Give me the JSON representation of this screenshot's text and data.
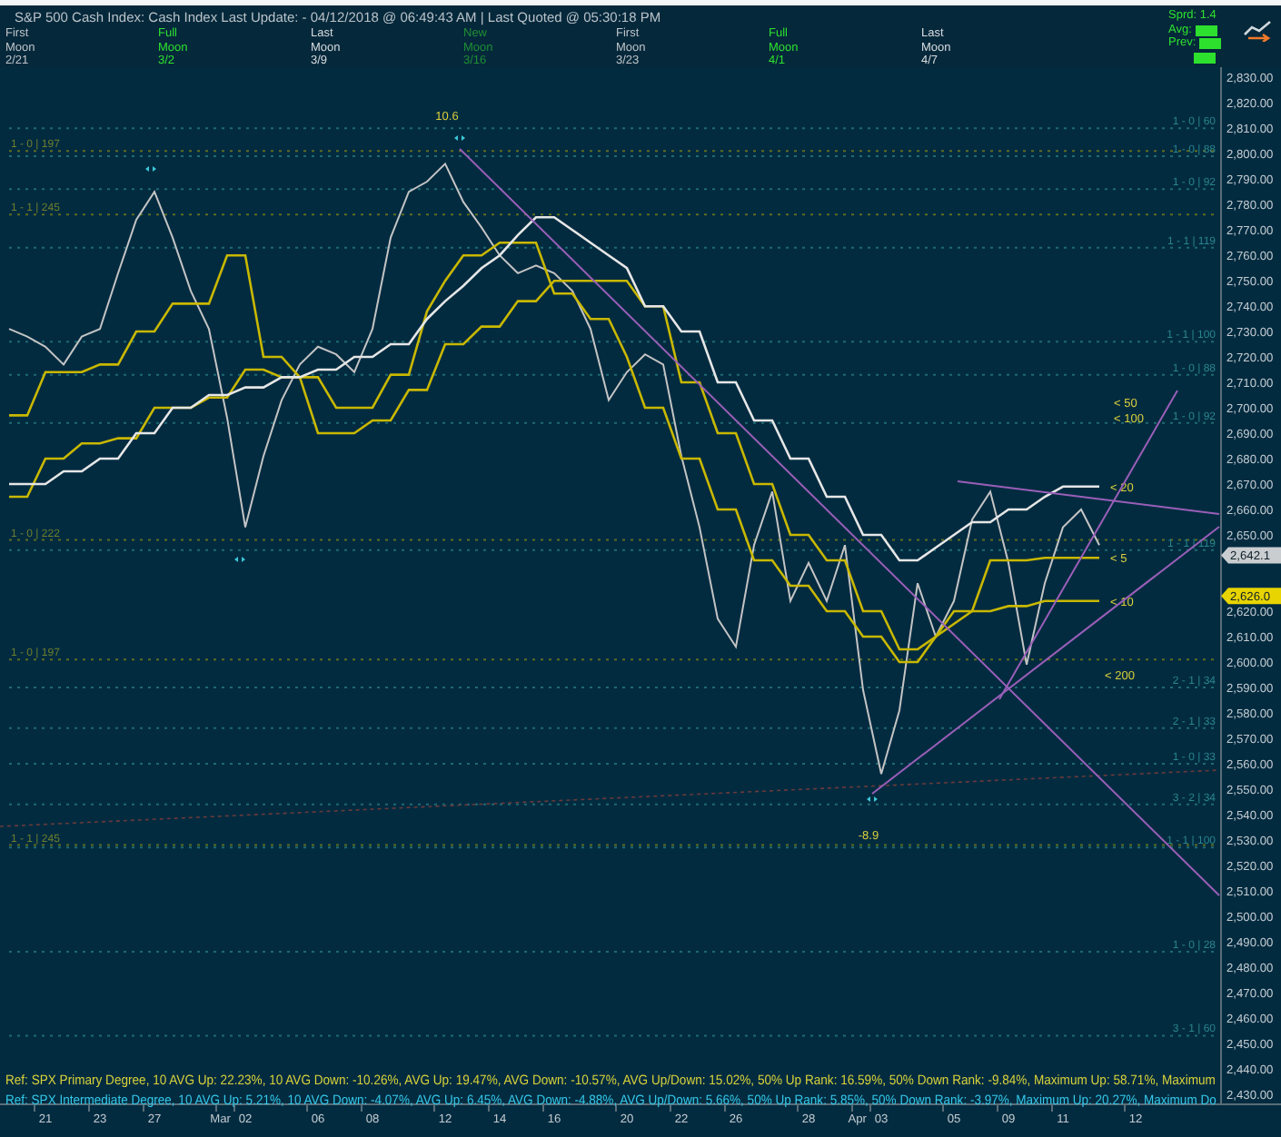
{
  "header": {
    "title_rest": ":  Cash Index  Last Update:  - 04/12/2018 @ 06:49:43 AM | Last Quoted @ 05:30:18 PM",
    "moon_phases": [
      {
        "kind": "first",
        "lines": [
          "First",
          "Moon",
          "2/21"
        ]
      },
      {
        "kind": "full",
        "lines": [
          "Full",
          "Moon",
          "3/2"
        ]
      },
      {
        "kind": "last",
        "lines": [
          "Last",
          "Moon",
          "3/9"
        ]
      },
      {
        "kind": "new",
        "lines": [
          "New",
          "Moon",
          "3/16"
        ]
      },
      {
        "kind": "first",
        "lines": [
          "First",
          "Moon",
          "3/23"
        ]
      },
      {
        "kind": "full",
        "lines": [
          "Full",
          "Moon",
          "4/1"
        ]
      },
      {
        "kind": "last",
        "lines": [
          "Last",
          "Moon",
          "4/7"
        ]
      }
    ],
    "spread": "Sprd: 1.4",
    "avg_label": "Avg:",
    "prev_label": "Prev:"
  },
  "chart": {
    "chart_data": {
      "type": "line",
      "grid": true,
      "ylim": [
        2426,
        2834
      ],
      "categories": [
        null,
        null,
        "21",
        null,
        null,
        "23",
        null,
        null,
        "27",
        null,
        null,
        null,
        "Mar",
        "02",
        null,
        null,
        null,
        "06",
        null,
        null,
        "08",
        null,
        null,
        null,
        "12",
        null,
        null,
        "14",
        null,
        null,
        "16",
        null,
        null,
        null,
        "20",
        null,
        null,
        "22",
        null,
        null,
        "26",
        null,
        null,
        null,
        "28",
        null,
        null,
        "Apr",
        "03",
        null,
        null,
        null,
        "05",
        null,
        null,
        "09",
        null,
        null,
        "11",
        null,
        null,
        null,
        "12"
      ],
      "yticks": [
        {
          "value": 2830,
          "label": "2,830.00"
        },
        {
          "value": 2820,
          "label": "2,820.00"
        },
        {
          "value": 2810,
          "label": "2,810.00"
        },
        {
          "value": 2800,
          "label": "2,800.00"
        },
        {
          "value": 2790,
          "label": "2,790.00"
        },
        {
          "value": 2780,
          "label": "2,780.00"
        },
        {
          "value": 2770,
          "label": "2,770.00"
        },
        {
          "value": 2760,
          "label": "2,760.00"
        },
        {
          "value": 2750,
          "label": "2,750.00"
        },
        {
          "value": 2740,
          "label": "2,740.00"
        },
        {
          "value": 2730,
          "label": "2,730.00"
        },
        {
          "value": 2720,
          "label": "2,720.00"
        },
        {
          "value": 2710,
          "label": "2,710.00"
        },
        {
          "value": 2700,
          "label": "2,700.00"
        },
        {
          "value": 2690,
          "label": "2,690.00"
        },
        {
          "value": 2680,
          "label": "2,680.00"
        },
        {
          "value": 2670,
          "label": "2,670.00"
        },
        {
          "value": 2660,
          "label": "2,660.00"
        },
        {
          "value": 2650,
          "label": "2,650.00"
        },
        {
          "value": 2620,
          "label": "2,620.00"
        },
        {
          "value": 2610,
          "label": "2,610.00"
        },
        {
          "value": 2600,
          "label": "2,600.00"
        },
        {
          "value": 2590,
          "label": "2,590.00"
        },
        {
          "value": 2580,
          "label": "2,580.00"
        },
        {
          "value": 2570,
          "label": "2,570.00"
        },
        {
          "value": 2560,
          "label": "2,560.00"
        },
        {
          "value": 2550,
          "label": "2,550.00"
        },
        {
          "value": 2540,
          "label": "2,540.00"
        },
        {
          "value": 2530,
          "label": "2,530.00"
        },
        {
          "value": 2520,
          "label": "2,520.00"
        },
        {
          "value": 2510,
          "label": "2,510.00"
        },
        {
          "value": 2500,
          "label": "2,500.00"
        },
        {
          "value": 2490,
          "label": "2,490.00"
        },
        {
          "value": 2480,
          "label": "2,480.00"
        },
        {
          "value": 2470,
          "label": "2,470.00"
        },
        {
          "value": 2460,
          "label": "2,460.00"
        },
        {
          "value": 2450,
          "label": "2,450.00"
        },
        {
          "value": 2440,
          "label": "2,440.00"
        },
        {
          "value": 2430,
          "label": "2,430.00"
        }
      ],
      "series": [
        {
          "name": "S&P 500 Cash Index",
          "color": "#c4c4c4",
          "values": [
            2731,
            2728,
            2724,
            2717,
            2728,
            2731,
            2753,
            2774,
            2785,
            2767,
            2746,
            2731,
            2696,
            2653,
            2681,
            2703,
            2717,
            2724,
            2721,
            2714,
            2731,
            2767,
            2785,
            2789,
            2796,
            2781,
            2771,
            2760,
            2753,
            2756,
            2753,
            2746,
            2731,
            2703,
            2714,
            2721,
            2717,
            2681,
            2653,
            2617,
            2606,
            2646,
            2667,
            2624,
            2639,
            2624,
            2646,
            2589,
            2556,
            2581,
            2631,
            2610,
            2624,
            2656,
            2667,
            2639,
            2599,
            2631,
            2653,
            2660,
            2646,
            null,
            null
          ]
        },
        {
          "name": "< 5",
          "color": "#c9b800",
          "values": [
            2697,
            2697,
            2714,
            2714,
            2714,
            2717,
            2717,
            2730,
            2730,
            2741,
            2741,
            2741,
            2760,
            2760,
            2720,
            2720,
            2712,
            2712,
            2700,
            2700,
            2700,
            2713,
            2713,
            2738,
            2750,
            2760,
            2760,
            2765,
            2765,
            2765,
            2745,
            2745,
            2735,
            2735,
            2720,
            2700,
            2700,
            2680,
            2680,
            2660,
            2660,
            2640,
            2640,
            2630,
            2630,
            2620,
            2620,
            2610,
            2610,
            2600,
            2600,
            2610,
            2620,
            2620,
            2640,
            2640,
            2640,
            2641,
            2641,
            2641,
            2641,
            null,
            null
          ]
        },
        {
          "name": "< 10",
          "color": "#c9b800",
          "values": [
            2665,
            2665,
            2680,
            2680,
            2686,
            2686,
            2688,
            2688,
            2700,
            2700,
            2700,
            2704,
            2704,
            2715,
            2715,
            2712,
            2712,
            2690,
            2690,
            2690,
            2695,
            2695,
            2707,
            2707,
            2725,
            2725,
            2732,
            2732,
            2742,
            2742,
            2750,
            2750,
            2750,
            2750,
            2750,
            2740,
            2740,
            2710,
            2710,
            2690,
            2690,
            2670,
            2670,
            2650,
            2650,
            2640,
            2640,
            2620,
            2620,
            2605,
            2605,
            2610,
            2615,
            2620,
            2620,
            2622,
            2622,
            2624,
            2624,
            2624,
            2624,
            null,
            null
          ]
        },
        {
          "name": "< 20",
          "color": "#e6e6e6",
          "values": [
            2670,
            2670,
            2670,
            2675,
            2675,
            2680,
            2680,
            2690,
            2690,
            2700,
            2700,
            2705,
            2705,
            2708,
            2708,
            2712,
            2712,
            2715,
            2715,
            2720,
            2720,
            2725,
            2725,
            2735,
            2742,
            2748,
            2755,
            2760,
            2768,
            2775,
            2775,
            2770,
            2765,
            2760,
            2755,
            2740,
            2740,
            2730,
            2730,
            2710,
            2710,
            2695,
            2695,
            2680,
            2680,
            2665,
            2665,
            2650,
            2650,
            2640,
            2640,
            2645,
            2650,
            2655,
            2655,
            2660,
            2660,
            2665,
            2669,
            2669,
            2669,
            null,
            null
          ]
        }
      ]
    },
    "level_labels_left": [
      "1 - 0 | 197",
      "1 - 1 | 245",
      "1 - 0 | 222",
      "1 - 0 | 197",
      "1 - 1 | 245"
    ],
    "level_labels_right": [
      "1 - 0 | 60",
      "1 - 0 | 88",
      "1 - 0 | 92",
      "1 - 1 | 119",
      "1 - 1 | 100",
      "1 - 0 | 88",
      "1 - 0 | 92",
      "1 - 1 | 119",
      "2 - 1 | 34",
      "2 - 1 | 33",
      "1 - 0 | 33",
      "3 - 2 | 34",
      "1 - 1 | 100",
      "1 - 0 | 28",
      "3 - 1 | 60"
    ],
    "extreme_labels": [
      "10.6",
      "-8.9"
    ],
    "average_labels": [
      "< 50",
      "< 100",
      "< 200"
    ],
    "price_tags": [
      {
        "kind": "last",
        "text": "2,642.1"
      },
      {
        "kind": "average",
        "text": "2,626.0"
      }
    ],
    "footer_lines": [
      {
        "kind": "primary",
        "text": "Ref: SPX Primary Degree, 10 AVG Up: 22.23%, 10 AVG Down: -10.26%, AVG Up: 19.47%, AVG Down: -10.57%, AVG Up/Down: 15.02%, 50%  Up Rank: 16.59%, 50% Down Rank: -9.84%, Maximum Up: 58.71%, Maximum"
      },
      {
        "kind": "intermediate",
        "text": "Ref: SPX Intermediate Degree, 10 AVG Up: 5.21%, 10 AVG Down: -4.07%, AVG Up: 6.45%, AVG Down: -4.88%, AVG Up/Down: 5.66%, 50%  Up Rank: 5.85%, 50% Down Rank: -3.97%, Maximum Up: 20.27%, Maximum Do"
      }
    ]
  }
}
